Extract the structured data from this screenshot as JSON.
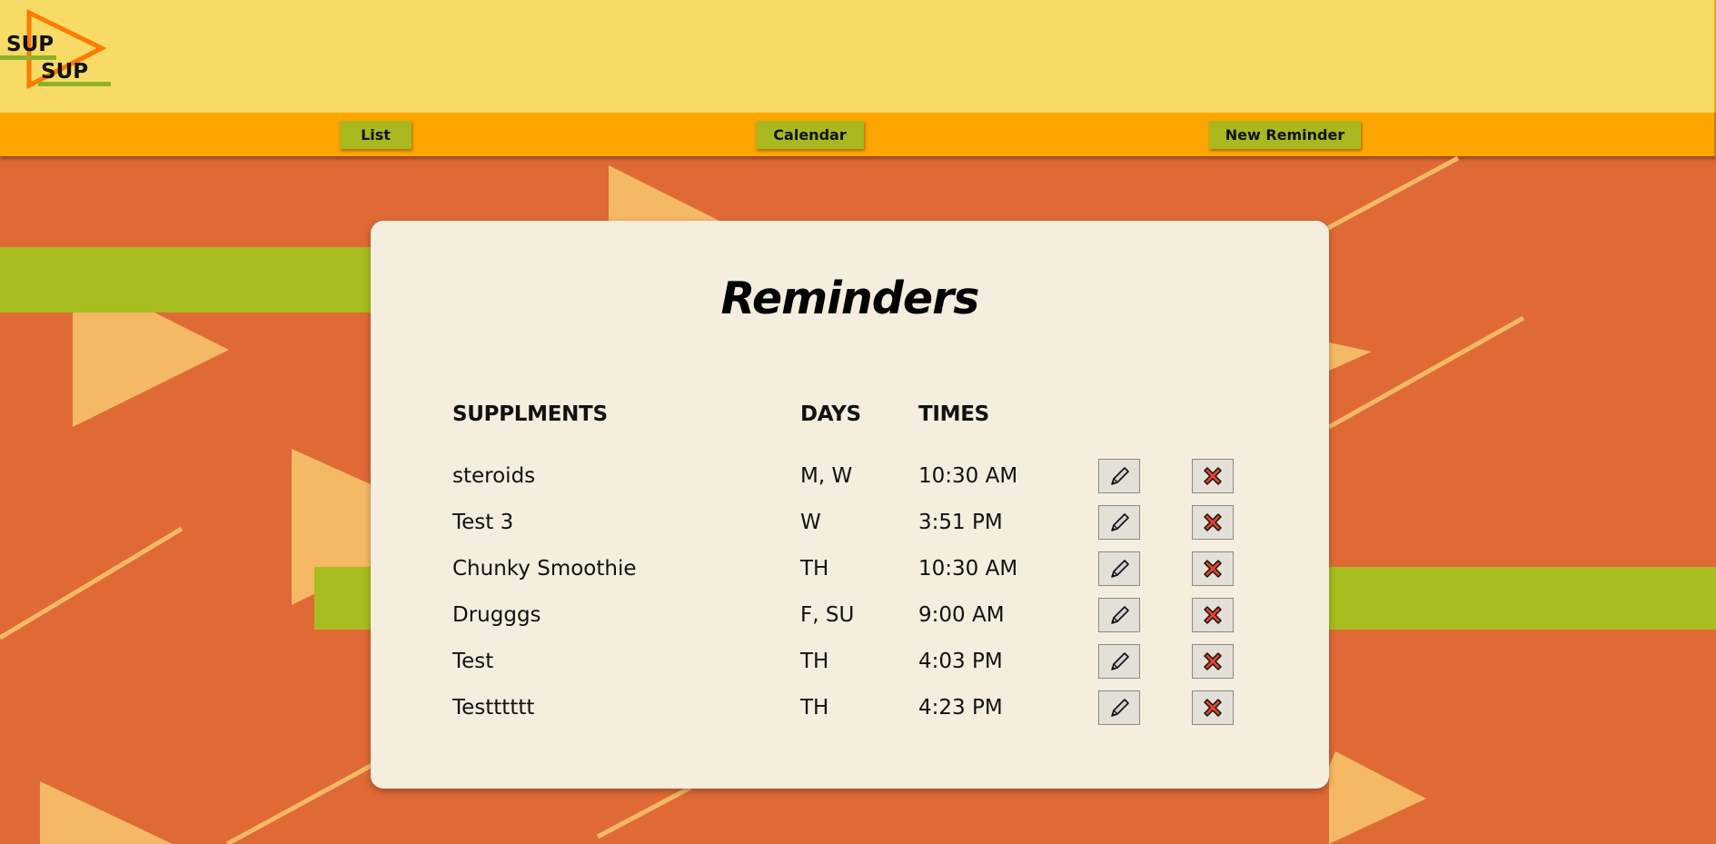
{
  "header": {
    "logo_line1": "SUP",
    "logo_line2": "SUP"
  },
  "nav": {
    "list_label": "List",
    "calendar_label": "Calendar",
    "new_reminder_label": "New Reminder"
  },
  "card": {
    "title": "Reminders",
    "columns": {
      "supplements": "SUPPLMENTS",
      "days": "DAYS",
      "times": "TIMES"
    },
    "rows": [
      {
        "name": "steroids",
        "days": "M, W",
        "time": "10:30 AM"
      },
      {
        "name": "Test 3",
        "days": "W",
        "time": "3:51 PM"
      },
      {
        "name": "Chunky Smoothie",
        "days": "TH",
        "time": "10:30 AM"
      },
      {
        "name": "Drugggs",
        "days": "F, SU",
        "time": "9:00 AM"
      },
      {
        "name": "Test",
        "days": "TH",
        "time": "4:03 PM"
      },
      {
        "name": "Testttttt",
        "days": "TH",
        "time": "4:23 PM"
      }
    ],
    "row_actions": {
      "edit_icon": "pencil-icon",
      "delete_icon": "close-icon"
    }
  },
  "colors": {
    "background": "#e06a36",
    "header": "#f7db66",
    "nav_bar": "#ffa500",
    "button": "#a8b81e",
    "card": "#f5eddd",
    "accent_triangle": "#f5b966",
    "accent_stripe": "#a8bd1f",
    "delete_red": "#e2452b"
  }
}
